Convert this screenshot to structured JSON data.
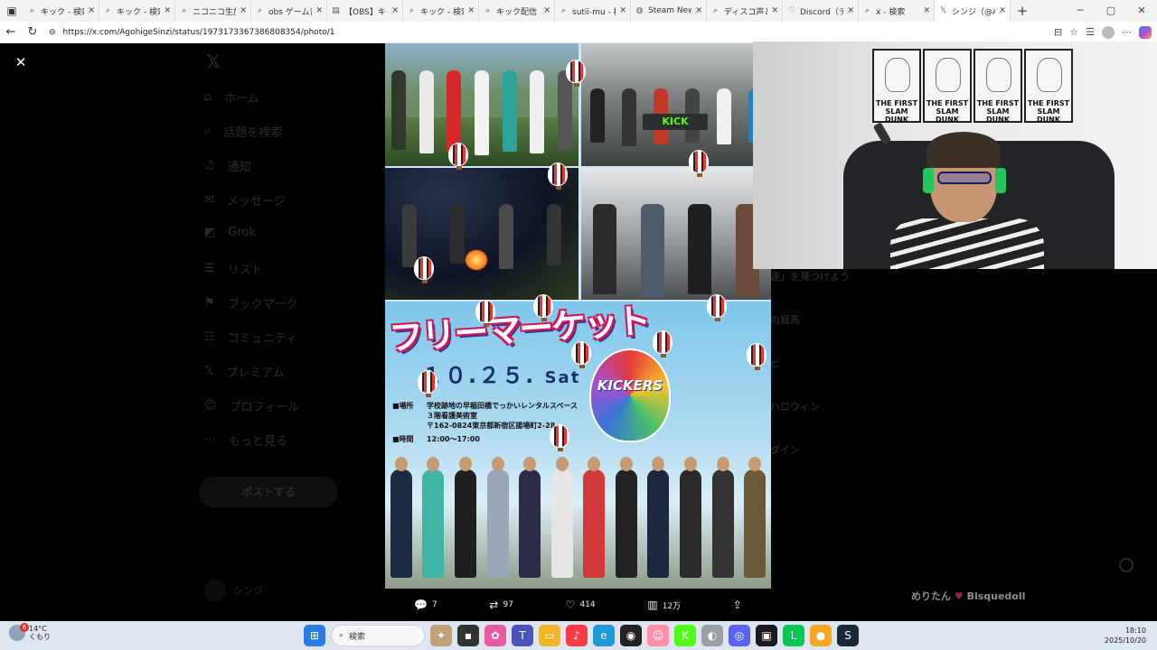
{
  "browser": {
    "tabs": [
      {
        "label": "キック - 検索",
        "icon": "search-icon"
      },
      {
        "label": "キック - 検索",
        "icon": "search-icon"
      },
      {
        "label": "ニコニコ生放送",
        "icon": "search-icon"
      },
      {
        "label": "obs ゲーム音",
        "icon": "search-icon"
      },
      {
        "label": "【OBS】キャプ",
        "icon": "page-icon"
      },
      {
        "label": "キック - 検索",
        "icon": "search-icon"
      },
      {
        "label": "キック配信 - ",
        "icon": "search-icon"
      },
      {
        "label": "sutii-mu - 検",
        "icon": "search-icon"
      },
      {
        "label": "Steam News",
        "icon": "steam-icon"
      },
      {
        "label": "ディスコ声とど",
        "icon": "search-icon"
      },
      {
        "label": "Discord（デ",
        "icon": "heart-icon"
      },
      {
        "label": "x - 検索",
        "icon": "search-icon"
      },
      {
        "label": "シンジ（@Ag",
        "icon": "x-logo-icon"
      }
    ],
    "url": "https://x.com/AgohigeSinzi/status/1973173367386808354/photo/1"
  },
  "x_nav": {
    "items": [
      {
        "label": "ホーム",
        "icon": "home-icon"
      },
      {
        "label": "話題を検索",
        "icon": "search-icon"
      },
      {
        "label": "通知",
        "icon": "bell-icon"
      },
      {
        "label": "メッセージ",
        "icon": "mail-icon"
      },
      {
        "label": "Grok",
        "icon": "grok-icon"
      },
      {
        "label": "リスト",
        "icon": "list-icon"
      },
      {
        "label": "ブックマーク",
        "icon": "bookmark-icon"
      },
      {
        "label": "コミュニティ",
        "icon": "community-icon"
      },
      {
        "label": "プレミアム",
        "icon": "x-logo-icon"
      },
      {
        "label": "プロフィール",
        "icon": "profile-icon"
      },
      {
        "label": "もっと見る",
        "icon": "more-icon"
      }
    ],
    "post_button": "ポストする",
    "profile_name": "シンジ"
  },
  "right_panel": [
    "達」を見つけよう",
    "の競馬",
    "ビ",
    "ハロウィン",
    "ダイン"
  ],
  "poster": {
    "title": "フリーマーケット",
    "date": "１０.２５.",
    "day": "Sat",
    "venue_label": "■場所",
    "venue_line1": "学校跡地の早稲田橋でっかいレンタルスペース",
    "venue_line2": "３階看護美術室",
    "venue_line3": "〒162-0824東京都新宿区揚場町2-28",
    "time_label": "■時間",
    "time_value": "12:00～17:00",
    "balloon_text": "KICKERS",
    "kick_sign": "KICK"
  },
  "actions": {
    "replies": "7",
    "reposts": "97",
    "likes": "414",
    "views": "12万"
  },
  "webcam": {
    "poster_text": [
      "THE FIRST SLAM DUNK",
      "THE FIRST SLAM DUNK",
      "THE FIRST SLAM DUNK",
      "THE FIRST SLAM DUNK"
    ]
  },
  "chat": {
    "user": "めりたん",
    "message": "Bisquedoll"
  },
  "taskbar": {
    "weather_temp": "14°C",
    "weather_text": "くもり",
    "notification_count": "6",
    "search_placeholder": "検索",
    "time": "18:10",
    "date": "2025/10/20"
  },
  "colors": {
    "background": "#000000",
    "kick_green": "#53fc18",
    "title_pink": "#d4145a",
    "taskbar": "#dfe6ef"
  }
}
